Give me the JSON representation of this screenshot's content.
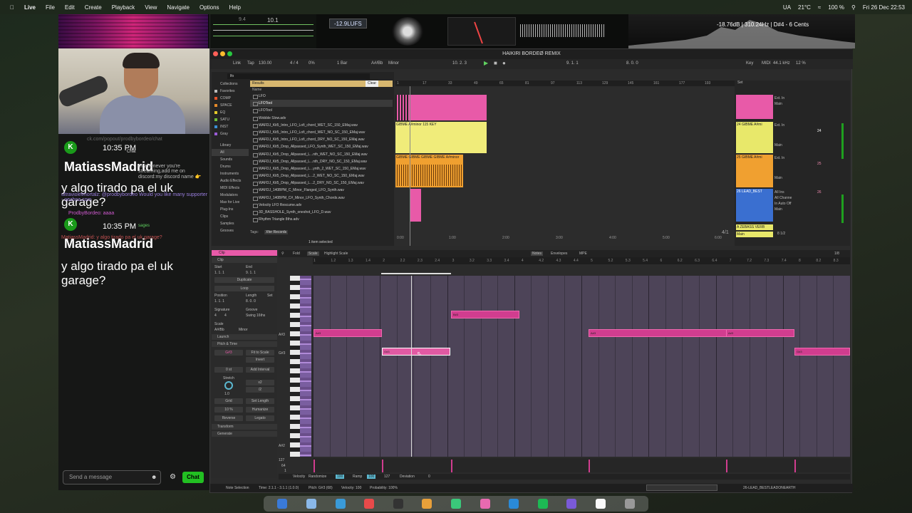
{
  "menubar": {
    "app": "Live",
    "items": [
      "File",
      "Edit",
      "Create",
      "Playback",
      "View",
      "Navigate",
      "Options",
      "Help"
    ],
    "weather": "21°C",
    "lang": "UA",
    "battery": "100 %",
    "datetime": "Fri 26 Dec  22:53"
  },
  "meters": {
    "lufs": "-12.9LUFS",
    "scope_val1": "9.4",
    "scope_val2": "10.1",
    "spectrum_readout": "-18.76dB | 310.24Hz | D#4 - 6 Cents"
  },
  "chat": {
    "url": "ck.com/popout/prodbybordeo/chat",
    "time1": "10:35 PM",
    "label1": "Chat",
    "name1": "MatiassMadrid",
    "msg_small1": "m whenever you're streaming,add me on discord:my discord name 👉",
    "msg_big1": "y algo tirado pa el uk garage?",
    "msg_small2": "ultravioletmortalz: @prodbybordeo Would you like many supporter - nezhna.com",
    "msg_small3": "ProdbyBordeo: aaaa",
    "time2": "10:35 PM",
    "label2": "sages",
    "msg_small4": "MatiassMadrid: y algo tirado pa el uk garage?",
    "name2": "MatiassMadrid",
    "msg_big2": "y algo tirado pa el uk garage?",
    "input_placeholder": "Send a message",
    "send_label": "Chat"
  },
  "ableton": {
    "title": "HAIKIRI BORDEØ REMIX",
    "transport": {
      "link": "Link",
      "tap": "Tap",
      "tempo": "130.00",
      "sig": "4 / 4",
      "pct": "0%",
      "bar": "1 Bar",
      "key": "A#/Bb",
      "scale": "Minor",
      "position": "10.  2.  3",
      "loop_start": "9.  1.  1",
      "loop_len": "8.  0.  0",
      "keybtn": "Key",
      "midi": "MIDI",
      "srate": "44.1 kHz",
      "cpu": "12 %"
    },
    "browser": {
      "search": "lfo",
      "collections_label": "Collections",
      "collections": [
        {
          "label": "Favorites",
          "color": "#bbbbbb"
        },
        {
          "label": "COMP",
          "color": "#e5522a"
        },
        {
          "label": "SPACE",
          "color": "#e58a2a"
        },
        {
          "label": "EQ",
          "color": "#e5c92a"
        },
        {
          "label": "SATU",
          "color": "#6dbb3a"
        },
        {
          "label": "INST",
          "color": "#3a8fd5"
        },
        {
          "label": "Gray",
          "color": "#9a5bd5"
        }
      ],
      "library_label": "Library",
      "library": [
        "All",
        "Sounds",
        "Drums",
        "Instruments",
        "Audio Effects",
        "MIDI Effects",
        "Modulators",
        "Max for Live",
        "Plug-Ins",
        "Clips",
        "Samples",
        "Grooves"
      ],
      "results_label": "Results",
      "clear_label": "Clear",
      "name_header": "Name",
      "results": [
        "LFO",
        "LFOTool",
        "LFOTool",
        "Wobble Slow.adv",
        "WAFDJ_Kit5_Intro_LFO_Lofi_chord_WET_SC_150_EMaj.wav",
        "WAFDJ_Kit5_Intro_LFO_Lofi_chord_WET_NO_SC_150_EMaj.wav",
        "WAFDJ_Kit5_Intro_LFO_Lofi_chord_DRY_NO_SC_150_EMaj.wav",
        "WAFDJ_Kit5_Drop_Allpassed_LFO_Synth_WET_SC_150_EMaj.wav",
        "WAFDJ_Kit5_Drop_Allpassed_L...nth_WET_NO_SC_150_EMaj.wav",
        "WAFDJ_Kit5_Drop_Allpassed_L...nth_DRY_NO_SC_150_EMaj.wav",
        "WAFDJ_Kit5_Drop_Allpassed_L...ynth_2_WET_SC_150_EMaj.wav",
        "WAFDJ_Kit5_Drop_Allpassed_L...2_WET_NO_SC_150_EMaj.wav",
        "WAFDJ_Kit5_Drop_Allpassed_L...2_DRY_NO_SC_150_EMaj.wav",
        "WAFDJ_140BPM_C_Minor_Flanged_LFO_Synth.wav",
        "WAFDJ_140BPM_C#_Minor_LFO_Synth_Chords.wav",
        "Velocity LFO Rescume.adv",
        "3D_BASSHOLE_Synth_oneshot_LFO_D.wav",
        "Rhythm Triangle 8ths.adv"
      ],
      "tags_label": "Tags:",
      "tags_value": "Xfer Records",
      "selected_info": "1 item selected"
    },
    "arrangement": {
      "ruler": [
        "1",
        "17",
        "33",
        "49",
        "65",
        "81",
        "97",
        "113",
        "129",
        "145",
        "161",
        "177",
        "193"
      ],
      "clip2_label": "GIBME A#minor 115 KEY",
      "clip3_label": "GIBME GIBME GIBME GIBME A#minor",
      "time_ruler": [
        "0:00",
        "1:00",
        "2:00",
        "3:00",
        "4:00",
        "5:00",
        "6:00"
      ],
      "ratio": "4/1"
    },
    "mixer": {
      "set_label": "Set",
      "tracks": [
        {
          "name": "",
          "color": "#e85aa8",
          "input": "Ext. In",
          "route": "Main",
          "vol": "24"
        },
        {
          "name": "24 GIBME A#mi",
          "color": "#e8e86a",
          "input": "Ext. In",
          "route": "Main",
          "vol": "24"
        },
        {
          "name": "25 GIBME A#mi",
          "color": "#f0a030",
          "input": "Ext. In",
          "route": "Main",
          "vol": "25"
        },
        {
          "name": "26 LEAD_BEST",
          "color": "#3a6fd0",
          "input": "All Ins",
          "route": "Main",
          "vol": "26",
          "channel": "All Channe",
          "monitor": "In  Auto  Off"
        }
      ],
      "return_name": "A ZEBASS VERB",
      "master_name": "Main",
      "master_val": "8 1/2"
    },
    "clip": {
      "clip_label": "Clip",
      "start": "Start",
      "end": "End",
      "start_val": "1.  1.  1",
      "end_val": "9.  1.  1",
      "duplicate": "Duplicate",
      "loop": "Loop",
      "position": "Position",
      "length": "Length",
      "set": "Set",
      "pos_val": "1.  1.  1",
      "len_val": "8.  0.  0",
      "signature": "Signature",
      "groove": "Groove",
      "sig_num": "4",
      "sig_den": "4",
      "groove_val": "Swing 16ths",
      "scale_label": "Scale",
      "scale_key": "A#/Bb",
      "scale_type": "Minor",
      "launch": "Launch",
      "pitch_time": "Pitch & Time",
      "note_sel": "G#3",
      "fit": "Fit to Scale",
      "invert": "Invert",
      "st": "0 st",
      "add_interval": "Add Interval",
      "stretch": "Stretch",
      "x2": "x2",
      "d2": "/2",
      "stretch_val": "1.0",
      "grid": "Grid",
      "set_length": "Set Length",
      "pct": "10 %",
      "humanize": "Humanize",
      "reverse": "Reverse",
      "legato": "Legato",
      "transform": "Transform",
      "generate": "Generate"
    },
    "pianoroll": {
      "fold": "Fold",
      "scale": "Scale",
      "highlight": "Highlight Scale",
      "notes_tab": "Notes",
      "envelopes_tab": "Envelopes",
      "mpe_tab": "MPE",
      "zoom": "1/8",
      "ruler": [
        "1",
        "1.2",
        "1.3",
        "1.4",
        "2",
        "2.2",
        "2.3",
        "2.4",
        "3",
        "3.2",
        "3.3",
        "3.4",
        "4",
        "4.2",
        "4.3",
        "4.4",
        "5",
        "5.2",
        "5.3",
        "5.4",
        "6",
        "6.2",
        "6.3",
        "6.4",
        "7",
        "7.2",
        "7.3",
        "7.4",
        "8",
        "8.2",
        "8.3"
      ],
      "row_labels": [
        "A#3",
        "G#3",
        "A#2"
      ],
      "notes": [
        {
          "label": "A#3",
          "pitch": "A#3"
        },
        {
          "label": "G#3",
          "pitch": "G#3"
        },
        {
          "label": "B#3",
          "pitch": "B#3"
        },
        {
          "label": "A#3",
          "pitch": "A#3"
        },
        {
          "label": "A#3",
          "pitch": "A#3"
        },
        {
          "label": "G#3",
          "pitch": "G#3"
        }
      ],
      "vel_127": "127",
      "vel_64": "64",
      "vel_1": "1",
      "velocity": "Velocity",
      "randomize": "Randomize",
      "rand_val": "100",
      "ramp": "Ramp",
      "ramp_val": "100",
      "ramp_val2": "127",
      "deviation": "Deviation",
      "dev_val": "0"
    },
    "status": {
      "mode": "Note Selection",
      "time": "Time: 2.1.1 - 3.1.1 (1.0.0)",
      "pitch": "Pitch: G#3 (68)",
      "velocity": "Velocity: 100",
      "prob": "Probability: 100%",
      "track": "26-LEAD_BESTLEADONEARTH"
    }
  }
}
